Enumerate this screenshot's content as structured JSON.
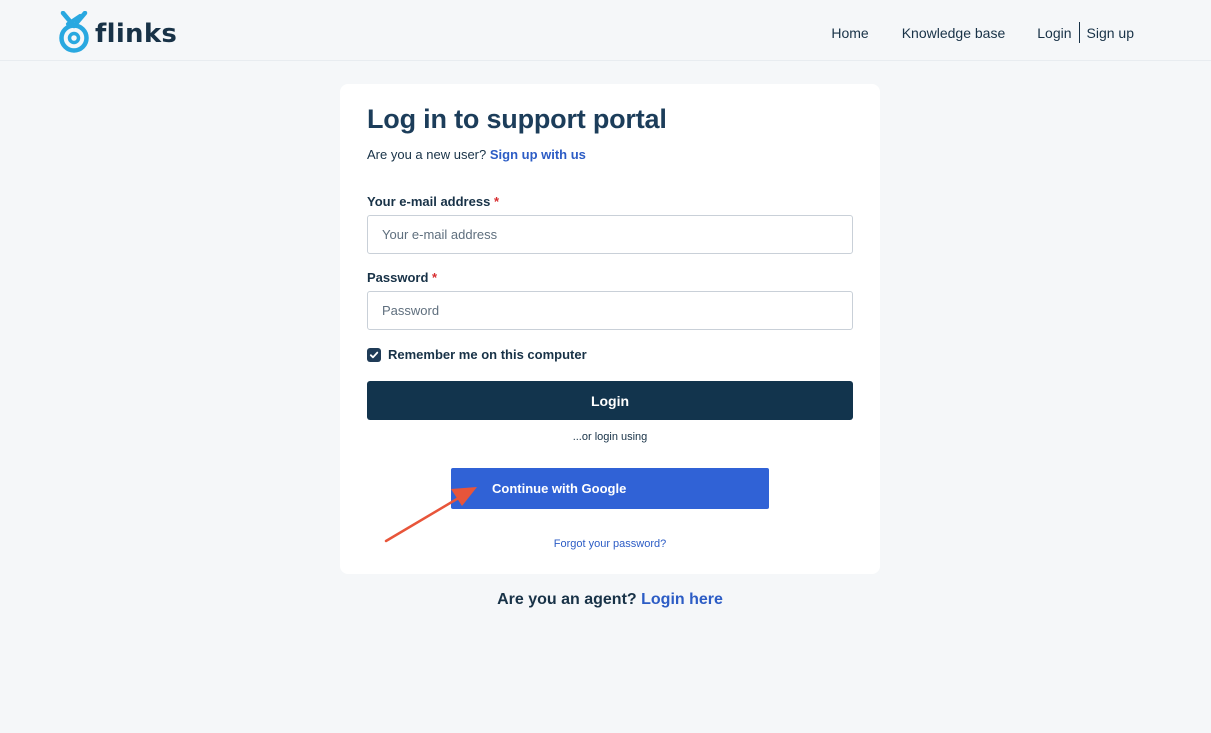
{
  "brand": {
    "name": "flinks"
  },
  "nav": {
    "home": "Home",
    "knowledge_base": "Knowledge base",
    "login": "Login",
    "signup": "Sign up"
  },
  "form": {
    "title": "Log in to support portal",
    "new_user_prompt": "Are you a new user?",
    "signup_link": "Sign up with us",
    "email_label": "Your e-mail address",
    "email_placeholder": "Your e-mail address",
    "email_value": "",
    "password_label": "Password",
    "password_placeholder": "Password",
    "password_value": "",
    "required_mark": "*",
    "remember_label": "Remember me on this computer",
    "remember_checked": true,
    "login_button": "Login",
    "or_text": "...or login using",
    "google_button": "Continue with Google",
    "forgot_link": "Forgot your password?"
  },
  "agent": {
    "prompt": "Are you an agent?",
    "link": "Login here"
  },
  "colors": {
    "background": "#f5f7f9",
    "primary_dark": "#12344d",
    "link_blue": "#2c5cc5",
    "google_blue": "#3062d6",
    "required_red": "#d72d30",
    "annotation_arrow": "#e8553a"
  }
}
